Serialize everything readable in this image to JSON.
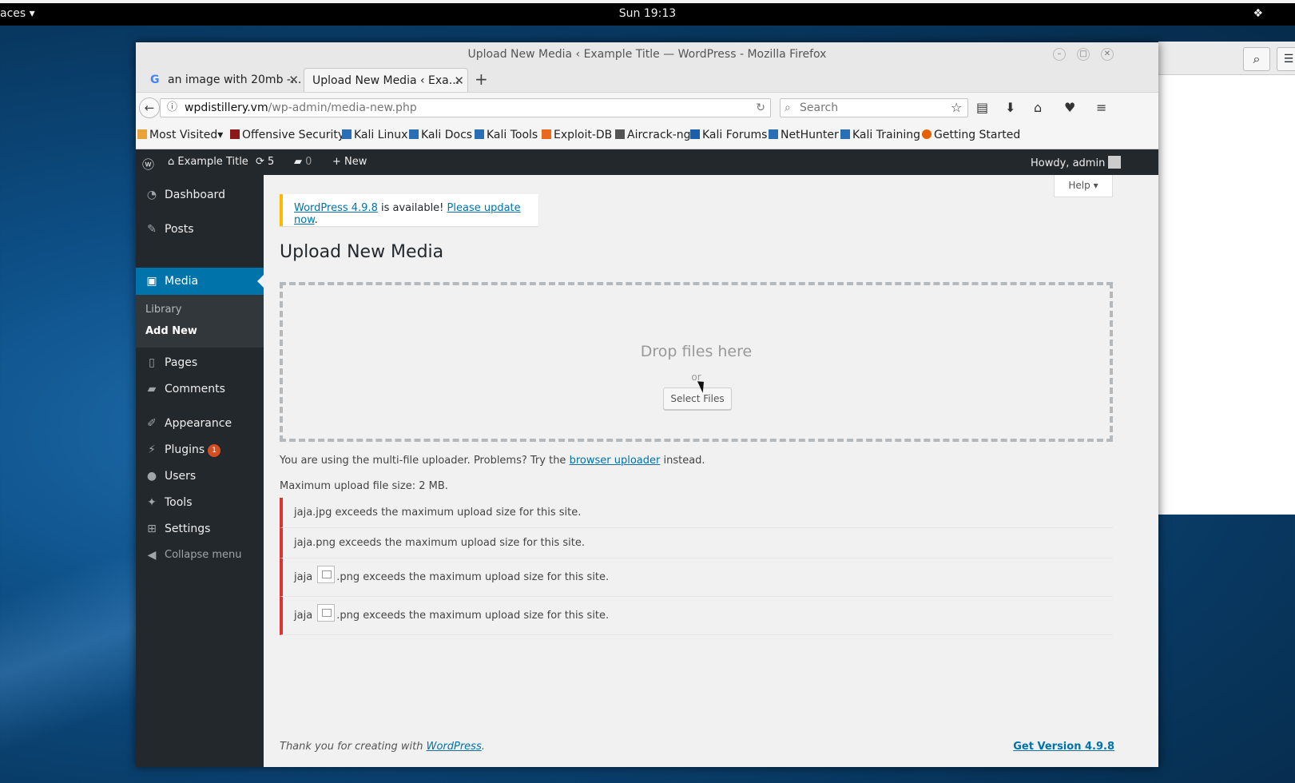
{
  "desktop": {
    "activities_label": "aces",
    "clock": "Sun 19:13"
  },
  "browser": {
    "window_title": "Upload New Media ‹ Example Title — WordPress - Mozilla Firefox",
    "tabs": [
      {
        "label": "an image with 20mb -..."
      },
      {
        "label": "Upload New Media ‹ Exa..."
      }
    ],
    "url_host": "wpdistillery.vm",
    "url_path": "/wp-admin/media-new.php",
    "search_placeholder": "Search",
    "bookmarks": [
      {
        "label": "Most Visited",
        "color": "#e8a33a"
      },
      {
        "label": "Offensive Security",
        "color": "#8b1a1a"
      },
      {
        "label": "Kali Linux",
        "color": "#2a6fb5"
      },
      {
        "label": "Kali Docs",
        "color": "#2a6fb5"
      },
      {
        "label": "Kali Tools",
        "color": "#2a6fb5"
      },
      {
        "label": "Exploit-DB",
        "color": "#e96a1e"
      },
      {
        "label": "Aircrack-ng",
        "color": "#555555"
      },
      {
        "label": "Kali Forums",
        "color": "#1c5fa8"
      },
      {
        "label": "NetHunter",
        "color": "#2a6fb5"
      },
      {
        "label": "Kali Training",
        "color": "#2a6fb5"
      },
      {
        "label": "Getting Started",
        "color": "#e66000"
      }
    ]
  },
  "adminbar": {
    "site_name": "Example Title",
    "updates_count": "5",
    "comments_count": "0",
    "new_label": "New",
    "howdy": "Howdy, admin"
  },
  "sidebar": {
    "items": [
      {
        "label": "Dashboard",
        "icon": "dashboard-icon"
      },
      {
        "label": "Posts",
        "icon": "pin-icon"
      },
      {
        "label": "Media",
        "icon": "media-icon"
      },
      {
        "label": "Pages",
        "icon": "pages-icon"
      },
      {
        "label": "Comments",
        "icon": "comment-icon"
      },
      {
        "label": "Appearance",
        "icon": "brush-icon"
      },
      {
        "label": "Plugins",
        "icon": "plug-icon"
      },
      {
        "label": "Users",
        "icon": "user-icon"
      },
      {
        "label": "Tools",
        "icon": "wrench-icon"
      },
      {
        "label": "Settings",
        "icon": "settings-icon"
      }
    ],
    "media_submenu": [
      "Library",
      "Add New"
    ],
    "plugins_badge": "1",
    "collapse_label": "Collapse menu"
  },
  "main": {
    "help_label": "Help",
    "notice": {
      "version_link": "WordPress 4.9.8",
      "middle_text": "is available!",
      "update_link": "Please update now",
      "end": "."
    },
    "page_title": "Upload New Media",
    "drop_text": "Drop files here",
    "or_text": "or",
    "select_button": "Select Files",
    "uploader_text_before": "You are using the multi-file uploader. Problems? Try the",
    "uploader_link": "browser uploader",
    "uploader_text_after": "instead.",
    "max_size": "Maximum upload file size: 2 MB.",
    "errors": [
      {
        "prefix": "jaja",
        "rest": ".jpg exceeds the maximum upload size for this site."
      },
      {
        "prefix": "jaja",
        "rest": ".png exceeds the maximum upload size for this site."
      },
      {
        "prefix": "jaja",
        "rest": ".png exceeds the maximum upload size for this site."
      },
      {
        "prefix": "jaja",
        "rest": ".png exceeds the maximum upload size for this site."
      }
    ],
    "footer_text": "Thank you for creating with",
    "footer_link": "WordPress",
    "footer_end": ".",
    "get_version": "Get Version 4.9.8"
  }
}
